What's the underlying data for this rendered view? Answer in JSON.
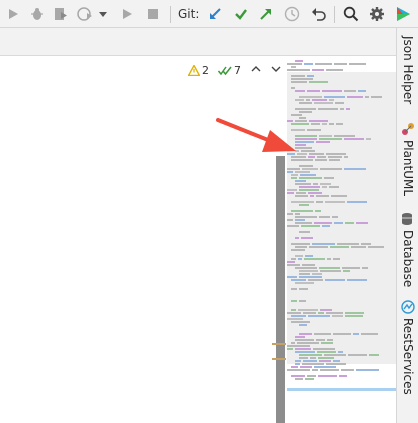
{
  "toolbar": {
    "git_label": "Git:",
    "icons": [
      "run-icon",
      "debug-icon",
      "run-with-coverage-icon",
      "profile-icon",
      "dropdown-arrow-icon",
      "resume-icon",
      "stop-icon",
      "update-project-icon",
      "commit-icon",
      "push-icon",
      "history-icon",
      "rollback-icon",
      "search-icon",
      "settings-icon",
      "plugin-icon"
    ]
  },
  "inspections": {
    "warnings_count": "2",
    "checks_count": "7"
  },
  "side_panel": {
    "tabs": [
      {
        "label": "Json Helper",
        "icon": "json-helper-icon"
      },
      {
        "label": "PlantUML",
        "icon": "plantuml-icon"
      },
      {
        "label": "Database",
        "icon": "database-icon"
      },
      {
        "label": "RestServices",
        "icon": "restservices-icon"
      }
    ]
  },
  "colors": {
    "accent_blue": "#2f80c8",
    "green": "#3a9a3a",
    "annotation_red": "#f04a3a",
    "warning_yellow": "#e0b400"
  }
}
